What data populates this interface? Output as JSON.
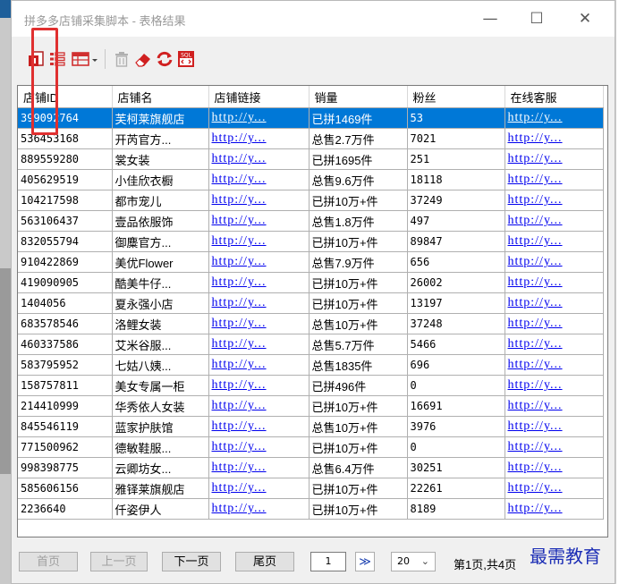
{
  "window": {
    "title": "拼多多店铺采集脚本 - 表格结果",
    "minimize_glyph": "—",
    "maximize_glyph": "☐",
    "close_glyph": "✕"
  },
  "toolbar": {
    "icons": [
      "export-excel-icon",
      "list-view-icon",
      "columns-view-icon",
      "dropdown-arrow-icon",
      "trash-icon",
      "eraser-icon",
      "refresh-icon",
      "sql-export-icon"
    ],
    "sql_label": "SQL"
  },
  "table": {
    "columns": [
      "店铺ID",
      "店铺名",
      "店铺链接",
      "销量",
      "粉丝",
      "在线客服"
    ],
    "rows": [
      {
        "id": "399092764",
        "name": "芙柯莱旗舰店",
        "link": "http://y...",
        "sales": "已拼1469件",
        "fans": "53",
        "service": "http://y..."
      },
      {
        "id": "536453168",
        "name": "开芮官方...",
        "link": "http://y...",
        "sales": "总售2.7万件",
        "fans": "7021",
        "service": "http://y..."
      },
      {
        "id": "889559280",
        "name": "裳女装",
        "link": "http://y...",
        "sales": "已拼1695件",
        "fans": "251",
        "service": "http://y..."
      },
      {
        "id": "405629519",
        "name": "小佳欣衣橱",
        "link": "http://y...",
        "sales": "总售9.6万件",
        "fans": "18118",
        "service": "http://y..."
      },
      {
        "id": "104217598",
        "name": "都市宠儿",
        "link": "http://y...",
        "sales": "已拼10万+件",
        "fans": "37249",
        "service": "http://y..."
      },
      {
        "id": "563106437",
        "name": "壹品依服饰",
        "link": "http://y...",
        "sales": "总售1.8万件",
        "fans": "497",
        "service": "http://y..."
      },
      {
        "id": "832055794",
        "name": "御麋官方...",
        "link": "http://y...",
        "sales": "已拼10万+件",
        "fans": "89847",
        "service": "http://y..."
      },
      {
        "id": "910422869",
        "name": "美优Flower",
        "link": "http://y...",
        "sales": "总售7.9万件",
        "fans": "656",
        "service": "http://y..."
      },
      {
        "id": "419090905",
        "name": "酷美牛仔...",
        "link": "http://y...",
        "sales": "已拼10万+件",
        "fans": "26002",
        "service": "http://y..."
      },
      {
        "id": "1404056",
        "name": "夏永强小店",
        "link": "http://y...",
        "sales": "已拼10万+件",
        "fans": "13197",
        "service": "http://y..."
      },
      {
        "id": "683578546",
        "name": "洛鲤女装",
        "link": "http://y...",
        "sales": "总售10万+件",
        "fans": "37248",
        "service": "http://y..."
      },
      {
        "id": "460337586",
        "name": "艾米谷服...",
        "link": "http://y...",
        "sales": "总售5.7万件",
        "fans": "5466",
        "service": "http://y..."
      },
      {
        "id": "583795952",
        "name": "七姑八姨...",
        "link": "http://y...",
        "sales": "总售1835件",
        "fans": "696",
        "service": "http://y..."
      },
      {
        "id": "158757811",
        "name": "美女专属一柜",
        "link": "http://y...",
        "sales": "已拼496件",
        "fans": "0",
        "service": "http://y..."
      },
      {
        "id": "214410999",
        "name": "华秀依人女装",
        "link": "http://y...",
        "sales": "已拼10万+件",
        "fans": "16691",
        "service": "http://y..."
      },
      {
        "id": "845546119",
        "name": "蓝家护肤馆",
        "link": "http://y...",
        "sales": "总售10万+件",
        "fans": "3976",
        "service": "http://y..."
      },
      {
        "id": "771500962",
        "name": "德敏鞋服...",
        "link": "http://y...",
        "sales": "已拼10万+件",
        "fans": "0",
        "service": "http://y..."
      },
      {
        "id": "998398775",
        "name": "云卿坊女...",
        "link": "http://y...",
        "sales": "总售6.4万件",
        "fans": "30251",
        "service": "http://y..."
      },
      {
        "id": "585606156",
        "name": "雅铎莱旗舰店",
        "link": "http://y...",
        "sales": "已拼10万+件",
        "fans": "22261",
        "service": "http://y..."
      },
      {
        "id": "2236640",
        "name": "仟姿伊人",
        "link": "http://y...",
        "sales": "已拼10万+件",
        "fans": "8189",
        "service": "http://y..."
      }
    ]
  },
  "pager": {
    "first_label": "首页",
    "prev_label": "上一页",
    "next_label": "下一页",
    "last_label": "尾页",
    "page_input": "1",
    "go_glyph": "≫",
    "page_size": "20",
    "page_info": "第1页,共4页"
  },
  "watermark": "最需教育",
  "colors": {
    "selection": "#0078d7",
    "link": "#0000ee",
    "highlight_box": "#e03030",
    "watermark": "#1b2db5"
  }
}
